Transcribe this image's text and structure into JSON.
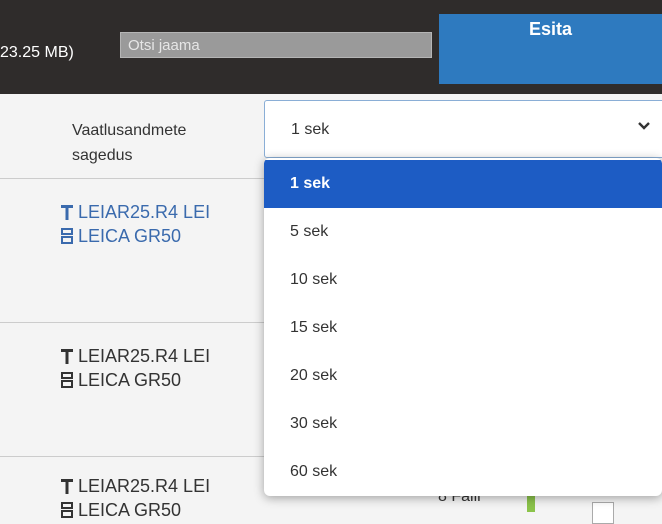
{
  "header": {
    "size_text": "23.25 MB)",
    "search_placeholder": "Otsi jaama",
    "submit_label": "Esita"
  },
  "frequency": {
    "label_line1": "Vaatlusandmete",
    "label_line2": "sagedus",
    "selected": "1 sek",
    "options": [
      "1 sek",
      "5 sek",
      "10 sek",
      "15 sek",
      "20 sek",
      "30 sek",
      "60 sek"
    ]
  },
  "stations": [
    {
      "antenna": "LEIAR25.R4 LEI",
      "receiver": "LEICA GR50"
    },
    {
      "antenna": "LEIAR25.R4 LEI",
      "receiver": "LEICA GR50"
    },
    {
      "antenna": "LEIAR25.R4 LEI",
      "receiver": "LEICA GR50"
    }
  ],
  "files": {
    "label": "8 Faili"
  },
  "colors": {
    "accent": "#2e7abf",
    "selected": "#1d5cc4",
    "link": "#3a6aad",
    "status_green": "#8bc34a"
  }
}
